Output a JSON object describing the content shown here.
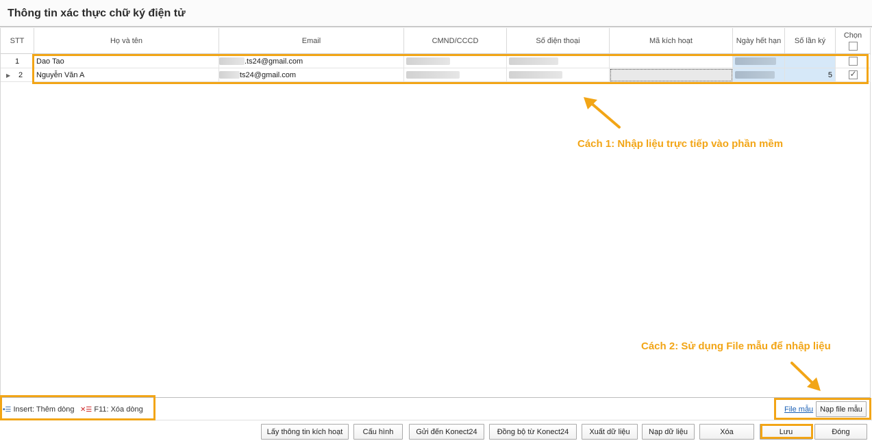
{
  "window": {
    "title": "Thông tin xác thực chữ ký điện tử"
  },
  "grid": {
    "columns": [
      "STT",
      "Họ và tên",
      "Email",
      "CMND/CCCD",
      "Số điện thoại",
      "Mã kích hoạt",
      "Ngày hết hạn",
      "Số lần ký",
      "Chọn"
    ],
    "rows": [
      {
        "stt": "1",
        "name": "Dao Tao",
        "email": ".ts24@gmail.com",
        "uses": "",
        "checked": false
      },
      {
        "stt": "2",
        "name": "Nguyễn Văn A",
        "email": "ts24@gmail.com",
        "uses": "5",
        "checked": true
      }
    ]
  },
  "annotations": {
    "method1": "Cách 1: Nhập liệu trực tiếp vào phần mềm",
    "method2": "Cách 2: Sử dụng File mẫu để nhập liệu"
  },
  "hints": {
    "insert": "Insert: Thêm dòng",
    "delete": "F11: Xóa dòng"
  },
  "template_link": "File mẫu",
  "load_template_button": "Nạp file mẫu",
  "toolbar": {
    "get_activation": "Lấy thông tin kích hoạt",
    "config": "Cấu hình",
    "send": "Gửi đến Konect24",
    "sync": "Đồng bộ từ Konect24",
    "export": "Xuất dữ liệu",
    "import": "Nạp dữ liệu",
    "delete": "Xóa",
    "save": "Lưu",
    "close": "Đóng"
  },
  "colors": {
    "highlight": "#f2a516",
    "link": "#1a5fb4",
    "selection": "#d6e8f8"
  },
  "icons": {
    "insert": "add-row-icon",
    "delete": "delete-row-icon",
    "row_pointer": "row-pointer-icon"
  }
}
